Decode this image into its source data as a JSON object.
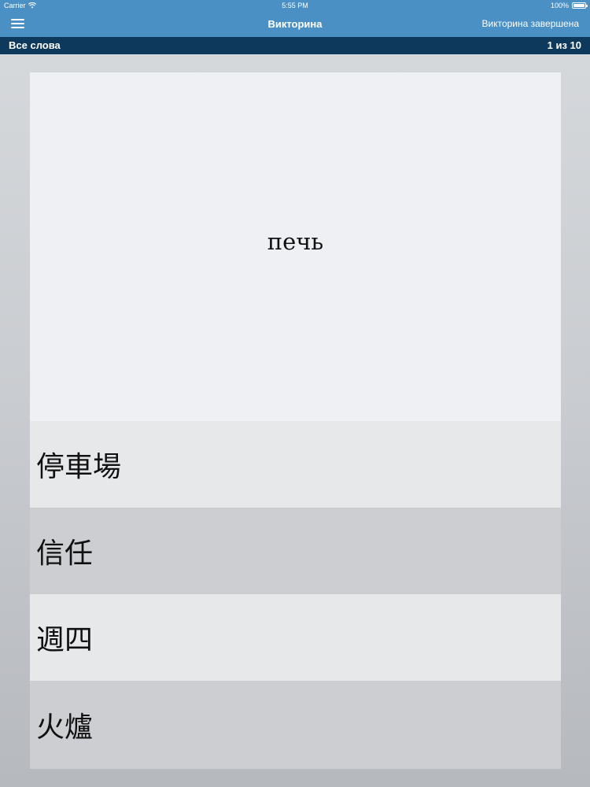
{
  "status_bar": {
    "carrier": "Carrier",
    "time": "5:55 PM",
    "battery": "100%",
    "icons": [
      "wifi-icon",
      "battery-icon"
    ]
  },
  "nav": {
    "title": "Викторина",
    "right_button": "Викторина завершена",
    "menu_icon": "hamburger-menu-icon"
  },
  "sub_header": {
    "category": "Все слова",
    "progress": "1 из 10"
  },
  "quiz": {
    "question": "печь",
    "answers": [
      {
        "label": "停車場"
      },
      {
        "label": "信任"
      },
      {
        "label": "週四"
      },
      {
        "label": "火爐"
      }
    ]
  },
  "colors": {
    "nav_bar": "#4a90c4",
    "sub_header": "#0d3a5c",
    "question_bg": "#eef0f3",
    "answer_light": "#e7e8ea",
    "answer_dark": "#cdced1"
  }
}
